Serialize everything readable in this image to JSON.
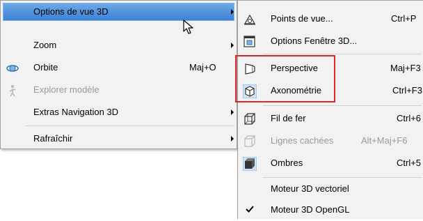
{
  "main_menu": {
    "items": [
      {
        "label": "Options de vue 3D",
        "has_submenu": true,
        "highlighted": true
      },
      {
        "label": "Zoom",
        "has_submenu": true
      },
      {
        "label": "Orbite",
        "shortcut": "Maj+O",
        "icon": "orbit-icon"
      },
      {
        "label": "Explorer modèle",
        "disabled": true,
        "icon": "explore-icon"
      },
      {
        "label": "Extras Navigation 3D",
        "has_submenu": true
      },
      {
        "label": "Rafraîchir",
        "has_submenu": true
      }
    ]
  },
  "sub_menu": {
    "items": [
      {
        "label": "Points de vue...",
        "shortcut": "Ctrl+P",
        "icon": "viewpoints-icon"
      },
      {
        "label": "Options Fenêtre 3D...",
        "icon": "window-options-icon"
      },
      {
        "label": "Perspective",
        "shortcut": "Maj+F3",
        "icon": "perspective-icon"
      },
      {
        "label": "Axonométrie",
        "shortcut": "Ctrl+F3",
        "icon": "axonometric-icon",
        "selected": true
      },
      {
        "label": "Fil de fer",
        "shortcut": "Ctrl+6",
        "icon": "wireframe-icon"
      },
      {
        "label": "Lignes cachées",
        "shortcut": "Alt+Maj+F6",
        "icon": "hidden-lines-icon",
        "disabled": true
      },
      {
        "label": "Ombres",
        "shortcut": "Ctrl+5",
        "icon": "shading-icon",
        "selected": true
      },
      {
        "label": "Moteur 3D vectoriel"
      },
      {
        "label": "Moteur 3D OpenGL",
        "checked": true,
        "icon": "checkmark-icon"
      }
    ]
  },
  "colors": {
    "menu_bg": "#f2f2f2",
    "highlight": "#3c82d6",
    "annotation_box": "#e3242b",
    "disabled_text": "#9b9b9b"
  }
}
